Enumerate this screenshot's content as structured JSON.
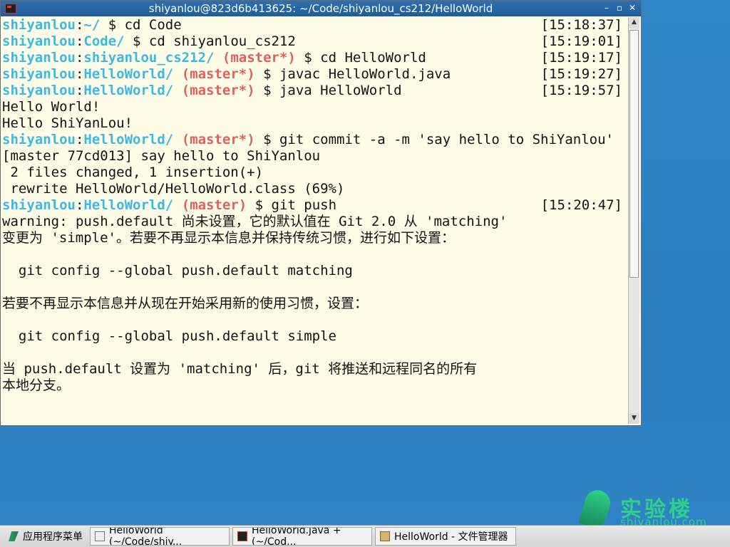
{
  "window": {
    "title": "shiyanlou@823d6b413625: ~/Code/shiyanlou_cs212/HelloWorld",
    "controls": [
      "–",
      "▫",
      "✕"
    ]
  },
  "terminal": {
    "lines": [
      {
        "u": "shiyanlou",
        "p": "~/",
        "b": "",
        "cmd": " $ cd Code",
        "ts": "[15:18:37]"
      },
      {
        "u": "shiyanlou",
        "p": "Code/",
        "b": "",
        "cmd": " $ cd shiyanlou_cs212",
        "ts": "[15:19:01]"
      },
      {
        "u": "shiyanlou",
        "p": "shiyanlou_cs212/",
        "b": " (master*)",
        "cmd": " $ cd HelloWorld",
        "ts": "[15:19:17]"
      },
      {
        "u": "shiyanlou",
        "p": "HelloWorld/",
        "b": " (master*)",
        "cmd": " $ javac HelloWorld.java",
        "ts": "[15:19:27]"
      },
      {
        "u": "shiyanlou",
        "p": "HelloWorld/",
        "b": " (master*)",
        "cmd": " $ java HelloWorld",
        "ts": "[15:19:57]"
      },
      {
        "text": "Hello World!"
      },
      {
        "text": "Hello ShiYanLou!"
      },
      {
        "u": "shiyanlou",
        "p": "HelloWorld/",
        "b": " (master*)",
        "cmd": " $ git commit -a -m 'say hello to ShiYanlou'",
        "ts": ""
      },
      {
        "text": "[master 77cd013] say hello to ShiYanlou"
      },
      {
        "text": " 2 files changed, 1 insertion(+)"
      },
      {
        "text": " rewrite HelloWorld/HelloWorld.class (69%)"
      },
      {
        "u": "shiyanlou",
        "p": "HelloWorld/",
        "b": " (master)",
        "cmd": " $ git push",
        "ts": "[15:20:47]"
      },
      {
        "text": "warning: push.default 尚未设置，它的默认值在 Git 2.0 从 'matching'"
      },
      {
        "text": "变更为 'simple'。若要不再显示本信息并保持传统习惯，进行如下设置："
      },
      {
        "text": ""
      },
      {
        "text": "  git config --global push.default matching"
      },
      {
        "text": ""
      },
      {
        "text": "若要不再显示本信息并从现在开始采用新的使用习惯，设置："
      },
      {
        "text": ""
      },
      {
        "text": "  git config --global push.default simple"
      },
      {
        "text": ""
      },
      {
        "text": "当 push.default 设置为 'matching' 后，git 将推送和远程同名的所有"
      },
      {
        "text": "本地分支。"
      }
    ]
  },
  "taskbar": {
    "start": "应用程序菜单",
    "items": [
      {
        "label": "HelloWorld (~/Code/shiy...",
        "icon": "editor-icon"
      },
      {
        "label": "HelloWorld.java + (~/Cod...",
        "icon": "terminal-icon"
      },
      {
        "label": "HelloWorld - 文件管理器",
        "icon": "folder-icon"
      }
    ]
  },
  "brand": {
    "name": "实验楼",
    "domain": "shiyanlou.com"
  },
  "colors": {
    "prompt": "#3ab8e6",
    "branch": "#e06060",
    "terminal_bg": "#fffde7",
    "desktop": "#2b7fbf"
  }
}
